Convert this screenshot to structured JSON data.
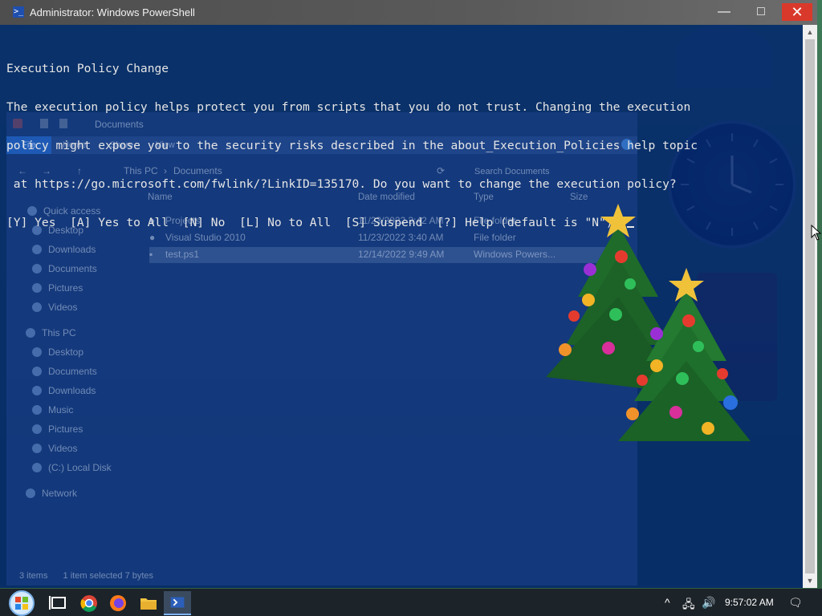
{
  "window": {
    "title": "Administrator: Windows PowerShell",
    "buttons": {
      "minimize": "—",
      "maximize": "□",
      "close": "✕"
    }
  },
  "console": {
    "lines": [
      "Execution Policy Change",
      "The execution policy helps protect you from scripts that you do not trust. Changing the execution",
      "policy might expose you to the security risks described in the about_Execution_Policies help topic",
      " at https://go.microsoft.com/fwlink/?LinkID=135170. Do you want to change the execution policy?",
      "[Y] Yes  [A] Yes to All  [N] No  [L] No to All  [S] Suspend  [?] Help (default is \"N\"): "
    ]
  },
  "explorer": {
    "title": "Documents",
    "tabs": {
      "file": "File",
      "home": "Home",
      "share": "Share",
      "view": "View"
    },
    "breadcrumb": {
      "root": "This PC",
      "sep": "›",
      "current": "Documents"
    },
    "search_placeholder": "Search Documents",
    "columns": {
      "name": "Name",
      "date": "Date modified",
      "type": "Type",
      "size": "Size"
    },
    "nav": {
      "quick_access": "Quick access",
      "qa_desktop": "Desktop",
      "qa_downloads": "Downloads",
      "qa_documents": "Documents",
      "qa_pictures": "Pictures",
      "qa_videos": "Videos",
      "this_pc": "This PC",
      "pc_desktop": "Desktop",
      "pc_documents": "Documents",
      "pc_downloads": "Downloads",
      "pc_music": "Music",
      "pc_pictures": "Pictures",
      "pc_videos": "Videos",
      "pc_localdisk": "(C:) Local Disk",
      "network": "Network"
    },
    "rows": [
      {
        "name": "Projects",
        "date": "11/23/2022 3:42 AM",
        "type": "File folder"
      },
      {
        "name": "Visual Studio 2010",
        "date": "11/23/2022 3:40 AM",
        "type": "File folder"
      },
      {
        "name": "test.ps1",
        "date": "12/14/2022 9:49 AM",
        "type": "Windows Powers..."
      }
    ],
    "status": {
      "items": "3 items",
      "selected": "1 item selected  7 bytes"
    }
  },
  "taskbar": {
    "clock": "9:57:02 AM",
    "icons": [
      "start-orb-icon",
      "task-view-icon",
      "chrome-icon",
      "firefox-icon",
      "file-explorer-icon",
      "powershell-icon"
    ],
    "tray": {
      "chevron": "^",
      "network": "🖧",
      "volume": "🔊",
      "notifications": "🗨"
    }
  },
  "colors": {
    "console_bg": "#00246e",
    "console_text": "#e6e6e6",
    "close_button": "#d9392b",
    "taskbar": "#1c2329"
  }
}
